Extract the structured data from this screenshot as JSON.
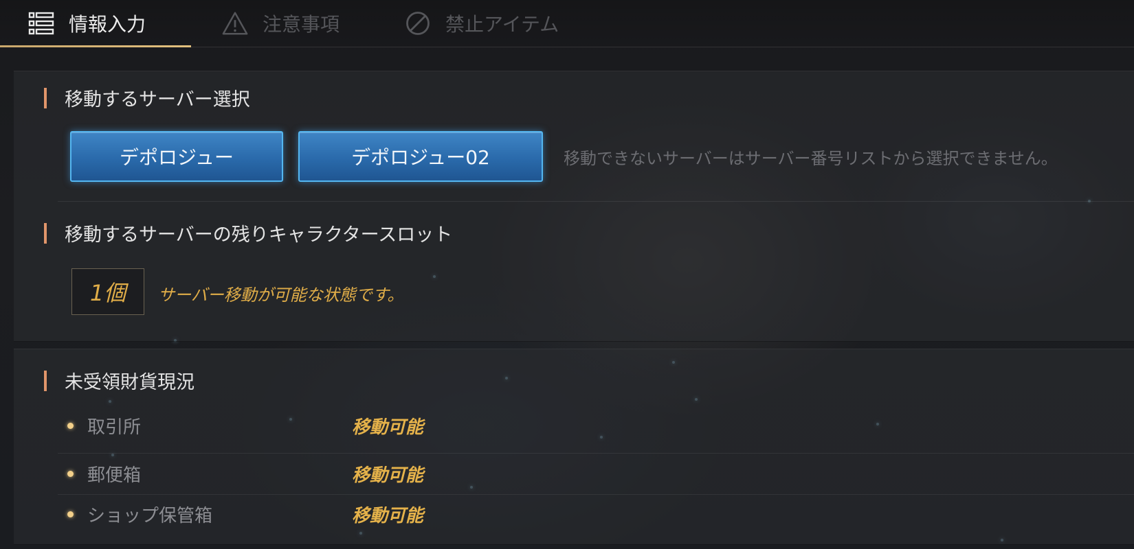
{
  "tabs": [
    {
      "label": "情報入力",
      "icon": "list-icon",
      "active": true
    },
    {
      "label": "注意事項",
      "icon": "warning-icon",
      "active": false
    },
    {
      "label": "禁止アイテム",
      "icon": "prohibited-icon",
      "active": false
    }
  ],
  "server_select": {
    "title": "移動するサーバー選択",
    "buttons": [
      "デポロジュー",
      "デポロジュー02"
    ],
    "note": "移動できないサーバーはサーバー番号リストから選択できません。"
  },
  "slots": {
    "title": "移動するサーバーの残りキャラクタースロット",
    "count": "1個",
    "status": "サーバー移動が可能な状態です。"
  },
  "currency": {
    "title": "未受領財貨現況",
    "rows": [
      {
        "label": "取引所",
        "value": "移動可能"
      },
      {
        "label": "郵便箱",
        "value": "移動可能"
      },
      {
        "label": "ショップ保管箱",
        "value": "移動可能"
      }
    ]
  },
  "colors": {
    "accent_gold": "#e0ad48",
    "tab_underline": "#d4b373",
    "section_marker": "#e0956a",
    "button_blue": "#2a6aab",
    "button_border": "#54b6f0"
  }
}
